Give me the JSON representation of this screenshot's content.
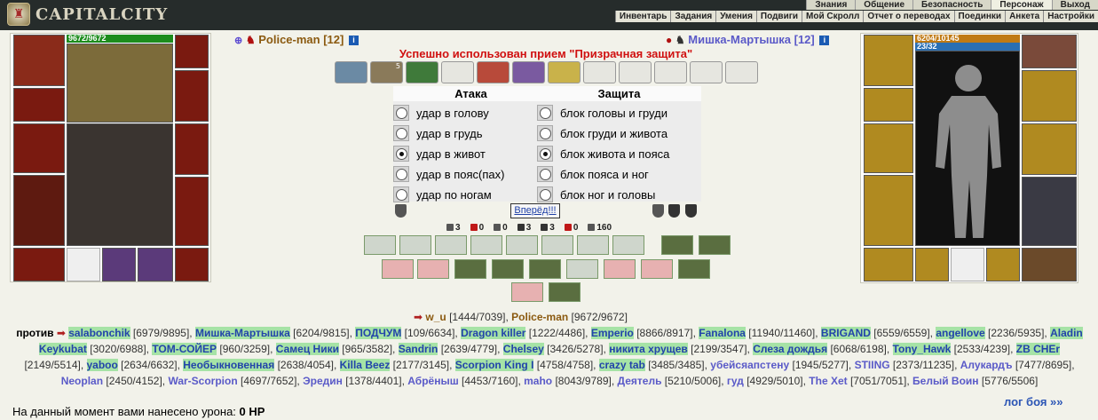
{
  "app": {
    "title": "CAPITALCITY"
  },
  "top_menu": [
    "Знания",
    "Общение",
    "Безопасность",
    "Персонаж",
    "Выход"
  ],
  "sub_menu": [
    "Инвентарь",
    "Задания",
    "Умения",
    "Подвиги",
    "Мой Скролл",
    "Отчет о переводах",
    "Поединки",
    "Анкета",
    "Настройки"
  ],
  "left_player": {
    "name": "Police-man [12]",
    "hp": "9672/9672",
    "hp_fraction": 1.0
  },
  "right_player": {
    "name": "Мишка-Мартышка [12]",
    "hp": "6204/10145",
    "mana": "23/32",
    "hp_fraction": 0.61,
    "mana_fraction": 0.72
  },
  "message": "Успешно использован прием \"Призрачная защита\"",
  "scroll_counter": "5",
  "attack": {
    "heading": "Атака",
    "options": [
      "удар в голову",
      "удар в грудь",
      "удар в живот",
      "удар в пояс(пах)",
      "удар по ногам"
    ],
    "selected": 2
  },
  "defense": {
    "heading": "Защита",
    "options": [
      "блок головы и груди",
      "блок груди и живота",
      "блок живота и пояса",
      "блок пояса и ног",
      "блок ног и головы"
    ],
    "selected": 2
  },
  "forward_button": "Вперёд!!!",
  "stats": [
    "3",
    "0",
    "0",
    "3",
    "3",
    "0",
    "160"
  ],
  "stat_colors": [
    "#555555",
    "#c01818",
    "#555555",
    "#333333",
    "#333333",
    "#c01818",
    "#555555"
  ],
  "vs_line": {
    "a_name": "w_u",
    "a_hp": "[1444/7039],",
    "b_name": "Police-man",
    "b_hp": "[9672/9672]"
  },
  "versus_label": "против",
  "roster": [
    {
      "n": "salabonchik",
      "h": "[6979/9895]",
      "hl": true
    },
    {
      "n": "Мишка-Мартышка",
      "h": "[6204/9815]",
      "hl": true
    },
    {
      "n": "ПОДЧУМ",
      "h": "[109/6634]",
      "hl": true
    },
    {
      "n": "Dragon killer",
      "h": "[1222/4486]",
      "hl": true
    },
    {
      "n": "Emperio",
      "h": "[8866/8917]",
      "hl": true
    },
    {
      "n": "Fanalona",
      "h": "[11940/11460]",
      "hl": true
    },
    {
      "n": "BRIGAND",
      "h": "[6559/6559]",
      "hl": true
    },
    {
      "n": "angellove",
      "h": "[2236/5935]",
      "hl": true
    },
    {
      "n": "Aladin Keykubat",
      "h": "[3020/6988]",
      "hl": true
    },
    {
      "n": "ТОМ-СОЙЕР",
      "h": "[960/3259]",
      "hl": true
    },
    {
      "n": "Самец Ники",
      "h": "[965/3582]",
      "hl": true
    },
    {
      "n": "Sandrin",
      "h": "[2639/4779]",
      "hl": true
    },
    {
      "n": "Chelsey",
      "h": "[3426/5278]",
      "hl": true
    },
    {
      "n": "никита хрущев",
      "h": "[2199/3547]",
      "hl": true
    },
    {
      "n": "Слеза дождья",
      "h": "[6068/6198]",
      "hl": true
    },
    {
      "n": "Tony_Hawk",
      "h": "[2533/4239]",
      "hl": true
    },
    {
      "n": "ZB CHEr",
      "h": "[2149/5514]",
      "hl": true
    },
    {
      "n": "yaboo",
      "h": "[2634/6632]",
      "hl": true
    },
    {
      "n": "Необыкновенная",
      "h": "[2638/4054]",
      "hl": true
    },
    {
      "n": "Killa Beez",
      "h": "[2177/3145]",
      "hl": true
    },
    {
      "n": "Scorpion King I",
      "h": "[4758/4758]",
      "hl": true
    },
    {
      "n": "crazy tab",
      "h": "[3485/3485]",
      "hl": true
    },
    {
      "n": "убейсяапстену",
      "h": "[1945/5277]",
      "hl": false
    },
    {
      "n": "STIING",
      "h": "[2373/11235]",
      "hl": false
    },
    {
      "n": "Алукардъ",
      "h": "[7477/8695]",
      "hl": false
    },
    {
      "n": "Neoplan",
      "h": "[2450/4152]",
      "hl": false
    },
    {
      "n": "War-Scorpion",
      "h": "[4697/7652]",
      "hl": false
    },
    {
      "n": "Эредин",
      "h": "[1378/4401]",
      "hl": false
    },
    {
      "n": "Абрёныш",
      "h": "[4453/7160]",
      "hl": false
    },
    {
      "n": "maho",
      "h": "[8043/9789]",
      "hl": false
    },
    {
      "n": "Деятель",
      "h": "[5210/5006]",
      "hl": false
    },
    {
      "n": "гуд",
      "h": "[4929/5010]",
      "hl": false
    },
    {
      "n": "The Xet",
      "h": "[7051/7051]",
      "hl": false
    },
    {
      "n": "Белый Воин",
      "h": "[5776/5506]",
      "hl": false
    }
  ],
  "damage": {
    "label": "На данный момент вами нанесено урона:",
    "value": "0 HP"
  },
  "log_link": "лог боя »»",
  "colors": {
    "topbar": "#262c2b",
    "hp": "#1c8c1c",
    "link": "#2b55b5",
    "highlight": "#a6e3a6",
    "message": "#d01010"
  }
}
